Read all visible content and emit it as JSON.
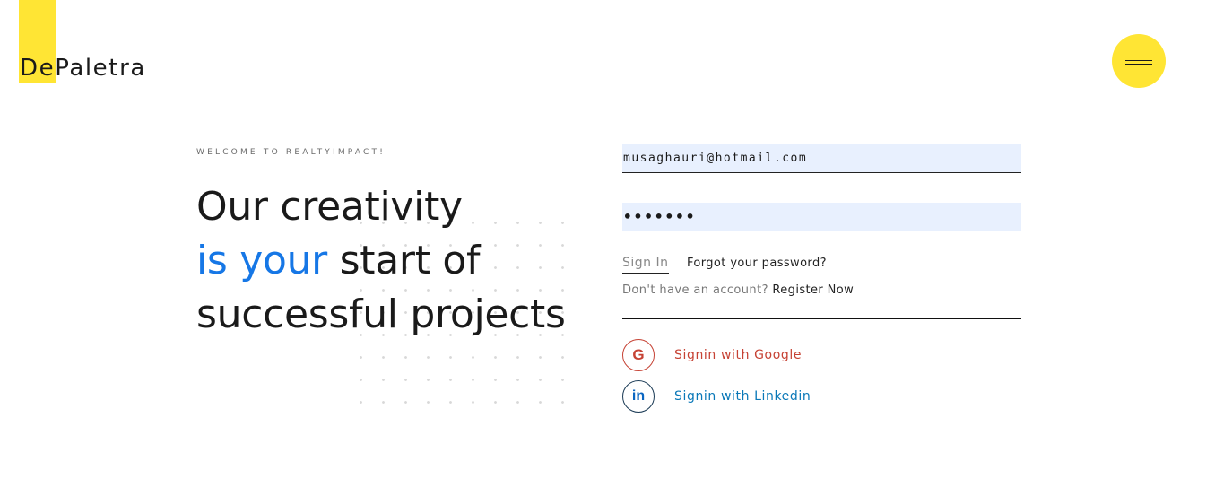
{
  "brand": {
    "logo_text": "DePaletra",
    "accent_color": "#ffe534"
  },
  "menu": {
    "icon": "hamburger-menu-icon"
  },
  "hero": {
    "eyebrow": "WELCOME TO REALTYIMPACT!",
    "line1": "Our creativity",
    "line2_accent": "is your",
    "line2_rest": " start of",
    "line3": "successful projects",
    "accent_color": "#1677e6"
  },
  "form": {
    "email_value": "musaghauri@hotmail.com",
    "password_value": "•••••••",
    "signin_label": "Sign In",
    "forgot_label": "Forgot your password?",
    "no_account_text": "Don't have an account?",
    "register_label": "Register Now",
    "google": {
      "icon": "google-icon",
      "glyph": "G",
      "label": "Signin with Google",
      "color": "#c64234"
    },
    "linkedin": {
      "icon": "linkedin-icon",
      "glyph": "in",
      "label": "Signin with Linkedin",
      "color": "#0a78b8"
    }
  }
}
